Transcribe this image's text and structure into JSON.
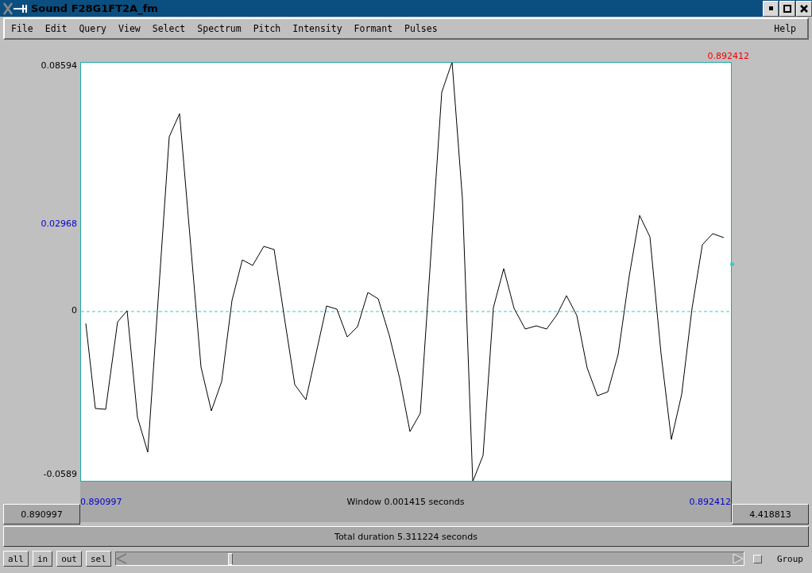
{
  "window": {
    "title": "Sound F28G1FT2A_fm"
  },
  "menu": [
    "File",
    "Edit",
    "Query",
    "View",
    "Select",
    "Spectrum",
    "Pitch",
    "Intensity",
    "Formant",
    "Pulses"
  ],
  "help": "Help",
  "plot": {
    "cursor_time": "0.892412",
    "y_labels": [
      {
        "text": "0.08594",
        "kind": "tick"
      },
      {
        "text": "0.02968",
        "kind": "cursor"
      },
      {
        "text": "0",
        "kind": "tick"
      },
      {
        "text": "-0.0589",
        "kind": "tick"
      }
    ]
  },
  "window_bar": {
    "start": "0.890997",
    "label": "Window 0.001415 seconds",
    "end": "0.892412"
  },
  "left_box": "0.890997",
  "right_box": "4.418813",
  "total": "Total duration 5.311224 seconds",
  "buttons": [
    "all",
    "in",
    "out",
    "sel"
  ],
  "group": {
    "label": "Group",
    "checked": false
  }
}
